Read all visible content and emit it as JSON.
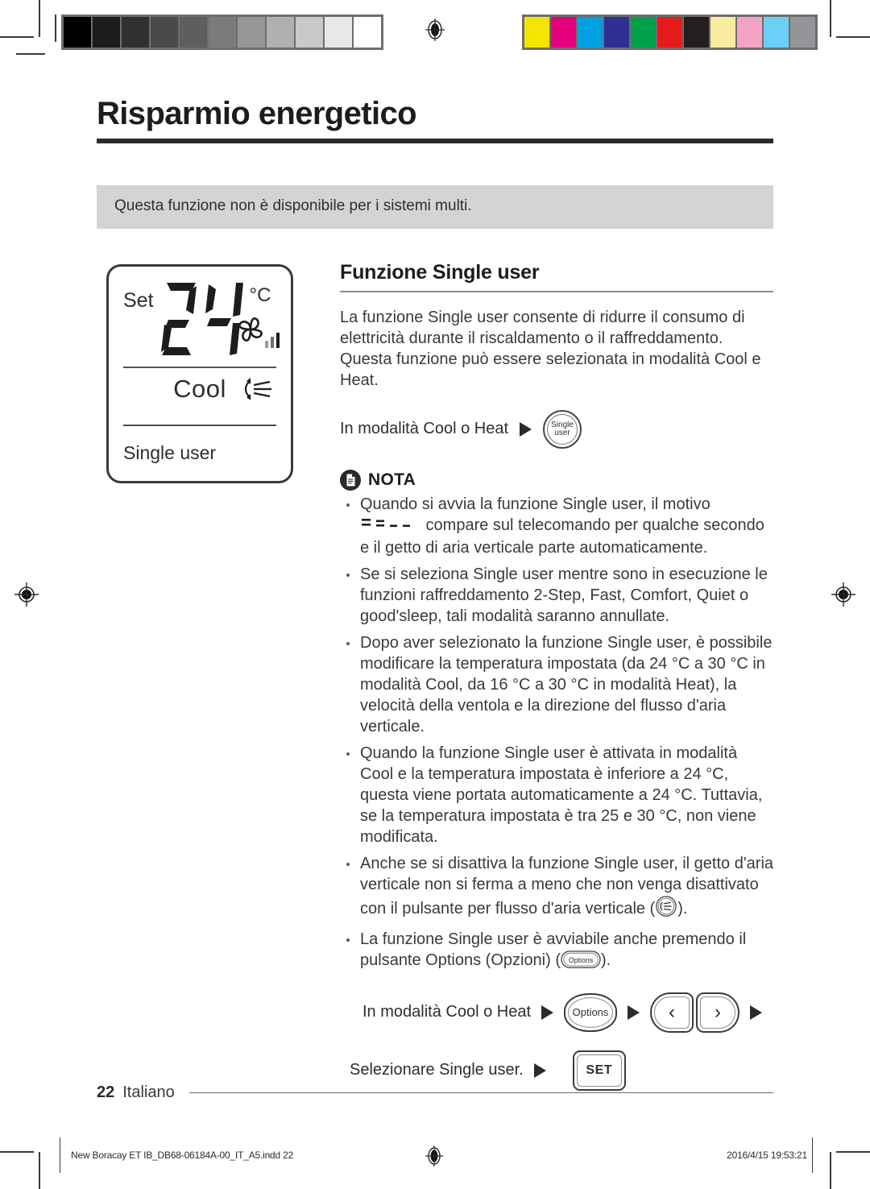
{
  "document": {
    "title": "Risparmio energetico",
    "callout": "Questa funzione non è disponibile per i sistemi multi.",
    "page_number": "22",
    "language": "Italiano"
  },
  "lcd": {
    "set_label": "Set",
    "temperature": "24",
    "unit": "°C",
    "mode": "Cool",
    "function": "Single user",
    "fan_icon": "fan-icon",
    "fan_bars_icon": "fan-speed-bars-icon",
    "airflow_icon": "vertical-airflow-icon"
  },
  "section": {
    "heading": "Funzione Single user",
    "paragraph": "La funzione Single user consente di ridurre il consumo di elettricità durante il riscaldamento o il raffreddamento. Questa funzione può essere selezionata in modalità Cool e Heat."
  },
  "step_primary": {
    "label": "In modalità Cool o Heat",
    "arrow_icon": "triangle-right-icon",
    "button_line1": "Single",
    "button_line2": "user"
  },
  "note": {
    "icon": "note-document-icon",
    "label": "NOTA",
    "items": [
      {
        "text_before": "Quando si avvia la funzione Single user, il motivo ",
        "inline_icon": "dash-pattern-icon",
        "text_after": " compare sul telecomando per qualche secondo e il getto di aria verticale parte automaticamente."
      },
      {
        "text_before": "Se si seleziona Single user mentre sono in esecuzione le funzioni raffreddamento 2-Step, Fast, Comfort, Quiet o good'sleep, tali modalità saranno annullate.",
        "inline_icon": "",
        "text_after": ""
      },
      {
        "text_before": "Dopo aver selezionato la funzione Single user, è possibile modificare la temperatura impostata (da 24 °C a 30 °C in modalità Cool, da 16 °C a 30 °C in modalità Heat), la velocità della ventola e la direzione del flusso d'aria verticale.",
        "inline_icon": "",
        "text_after": ""
      },
      {
        "text_before": "Quando la funzione Single user è attivata in modalità Cool e la temperatura impostata è inferiore a 24 °C, questa viene portata automaticamente a 24 °C. Tuttavia, se la temperatura impostata è tra 25 e 30 °C, non viene modificata.",
        "inline_icon": "",
        "text_after": ""
      },
      {
        "text_before": "Anche se si disattiva la funzione Single user, il getto d'aria verticale non si ferma a meno che non venga disattivato con il pulsante per flusso d'aria verticale (",
        "inline_icon": "vertical-airflow-button-icon",
        "text_after": ")."
      },
      {
        "text_before": "La funzione Single user è avviabile anche premendo il pulsante Options (Opzioni) (",
        "inline_icon": "options-button-icon",
        "text_after": ")."
      }
    ]
  },
  "sequence": {
    "row1_label": "In modalità Cool o Heat",
    "options_label": "Options",
    "chevron_left": "‹",
    "chevron_right": "›",
    "row2_label": "Selezionare Single user.",
    "set_label": "SET"
  },
  "print_bar": {
    "file": "New Boracay ET IB_DB68-06184A-00_IT_A5.indd   22",
    "timestamp": "2016/4/15   19:53:21",
    "registration_icon": "registration-target-icon"
  },
  "calibration": {
    "grayscale": [
      "#000000",
      "#1c1c1c",
      "#303030",
      "#4a4a4a",
      "#5e5e5e",
      "#7b7b7b",
      "#979797",
      "#b0b0b0",
      "#c9c9c9",
      "#e8e8e8",
      "#ffffff"
    ],
    "colors": [
      "#f5e400",
      "#e5007e",
      "#00a0e2",
      "#2e3192",
      "#00a04a",
      "#e51c1c",
      "#231f20",
      "#f8eca0",
      "#f4a3c4",
      "#6dcff6",
      "#939598"
    ]
  }
}
